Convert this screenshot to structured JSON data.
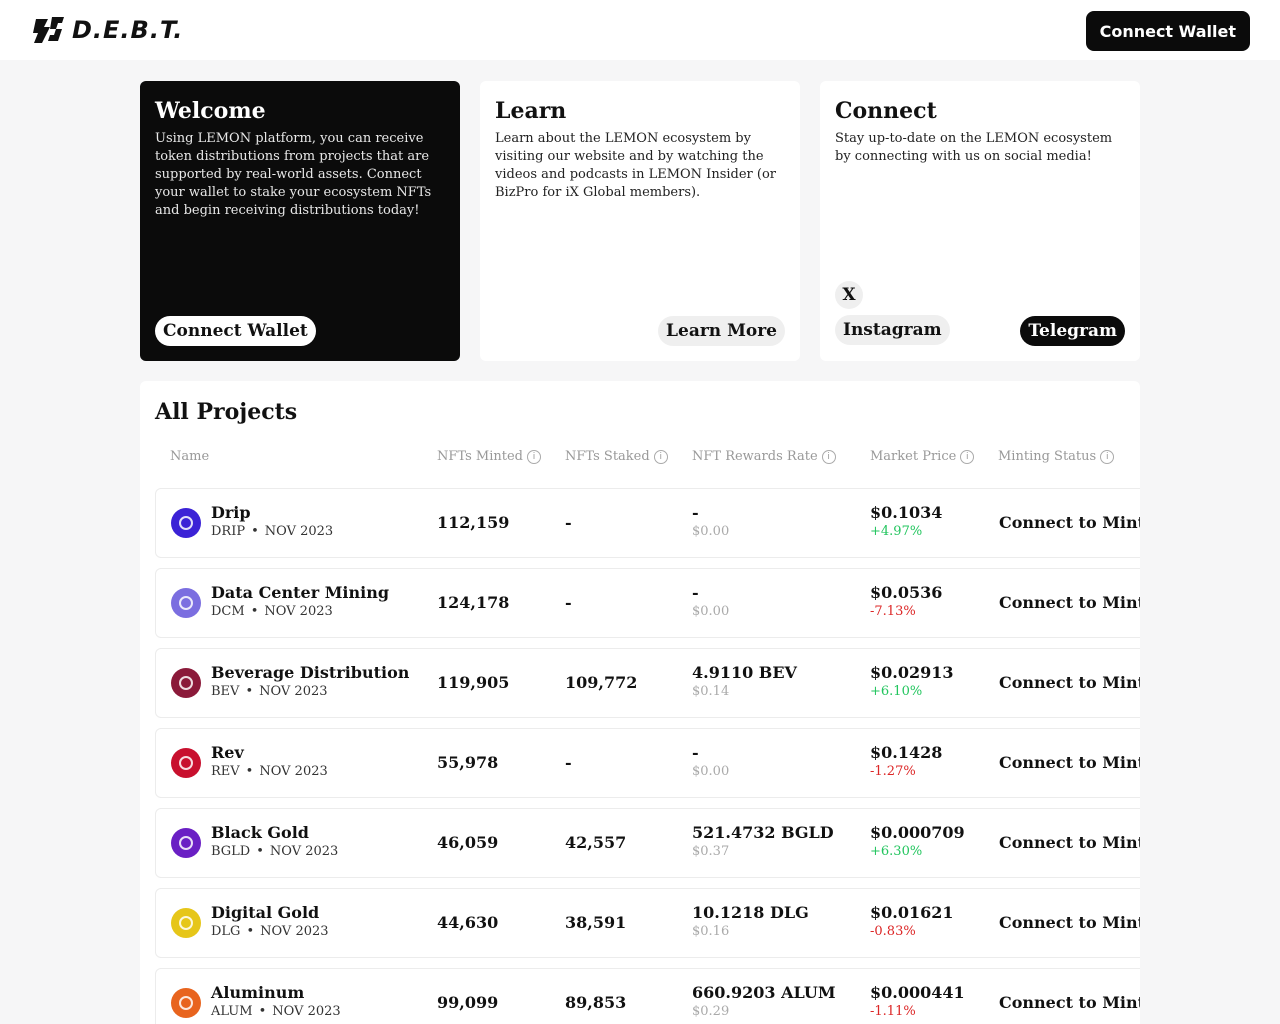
{
  "header": {
    "logo_text": "D.E.B.T.",
    "connect_label": "Connect Wallet"
  },
  "cards": {
    "welcome": {
      "title": "Welcome",
      "body": "Using LEMON platform, you can receive token distributions from projects that are supported by real-world assets. Connect your wallet to stake your ecosystem NFTs and begin receiving distributions today!",
      "button": "Connect Wallet"
    },
    "learn": {
      "title": "Learn",
      "body": "Learn about the LEMON ecosystem by visiting our website and by watching the videos and podcasts in LEMON Insider (or BizPro for iX Global members).",
      "button": "Learn More"
    },
    "connect": {
      "title": "Connect",
      "body": "Stay up-to-date on the LEMON ecosystem by connecting with us on social media!",
      "x": "X",
      "instagram": "Instagram",
      "telegram": "Telegram"
    }
  },
  "projects": {
    "title": "All Projects",
    "columns": {
      "name": "Name",
      "minted": "NFTs Minted",
      "staked": "NFTs Staked",
      "rewards": "NFT Rewards Rate",
      "price": "Market Price",
      "status": "Minting Status"
    },
    "info_glyph": "i",
    "separator": "•",
    "rows": [
      {
        "name": "Drip",
        "symbol": "DRIP",
        "date": "NOV 2023",
        "minted": "112,159",
        "staked": "-",
        "rate": "-",
        "rate_usd": "$0.00",
        "price": "$0.1034",
        "change": "+4.97%",
        "status": "Connect to Mint",
        "color": "#3b22d6"
      },
      {
        "name": "Data Center Mining",
        "symbol": "DCM",
        "date": "NOV 2023",
        "minted": "124,178",
        "staked": "-",
        "rate": "-",
        "rate_usd": "$0.00",
        "price": "$0.0536",
        "change": "-7.13%",
        "status": "Connect to Mint",
        "color": "#7b6ee0"
      },
      {
        "name": "Beverage Distribution",
        "symbol": "BEV",
        "date": "NOV 2023",
        "minted": "119,905",
        "staked": "109,772",
        "rate": "4.9110 BEV",
        "rate_usd": "$0.14",
        "price": "$0.02913",
        "change": "+6.10%",
        "status": "Connect to Mint",
        "color": "#8b1a3a"
      },
      {
        "name": "Rev",
        "symbol": "REV",
        "date": "NOV 2023",
        "minted": "55,978",
        "staked": "-",
        "rate": "-",
        "rate_usd": "$0.00",
        "price": "$0.1428",
        "change": "-1.27%",
        "status": "Connect to Mint",
        "color": "#c8102e"
      },
      {
        "name": "Black Gold",
        "symbol": "BGLD",
        "date": "NOV 2023",
        "minted": "46,059",
        "staked": "42,557",
        "rate": "521.4732 BGLD",
        "rate_usd": "$0.37",
        "price": "$0.000709",
        "change": "+6.30%",
        "status": "Connect to Mint",
        "color": "#6a1fc4"
      },
      {
        "name": "Digital Gold",
        "symbol": "DLG",
        "date": "NOV 2023",
        "minted": "44,630",
        "staked": "38,591",
        "rate": "10.1218 DLG",
        "rate_usd": "$0.16",
        "price": "$0.01621",
        "change": "-0.83%",
        "status": "Connect to Mint",
        "color": "#e6c619"
      },
      {
        "name": "Aluminum",
        "symbol": "ALUM",
        "date": "NOV 2023",
        "minted": "99,099",
        "staked": "89,853",
        "rate": "660.9203 ALUM",
        "rate_usd": "$0.29",
        "price": "$0.000441",
        "change": "-1.11%",
        "status": "Connect to Mint",
        "color": "#e8641e"
      }
    ]
  }
}
